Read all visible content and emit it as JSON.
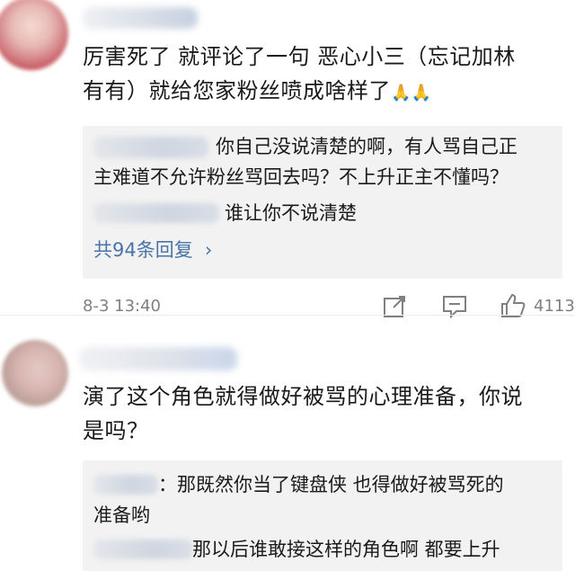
{
  "comments": [
    {
      "content_line1": "厉害死了 就评论了一句 恶心小三（忘记加林",
      "content_line2": "有有）就给您家粉丝喷成啥样了",
      "emoji": "🙏🙏",
      "replies": [
        {
          "text_line1": "你自己没说清楚的啊，有人骂自己正",
          "text_line2": "主难道不允许粉丝骂回去吗？不上升正主不懂吗？"
        },
        {
          "text_line1": "谁让你不说清楚"
        }
      ],
      "more_replies": "共94条回复",
      "timestamp": "8-3 13:40",
      "like_count": "4113"
    },
    {
      "content_line1": "演了这个角色就得做好被骂的心理准备，你说",
      "content_line2": "是吗？",
      "replies": [
        {
          "text_line1": "：那既然你当了键盘侠 也得做好被骂死的",
          "text_line2": "准备哟"
        },
        {
          "text_line1": "那以后谁敢接这样的角色啊 都要上升"
        }
      ]
    }
  ],
  "icons": {
    "share": "share-icon",
    "comment": "comment-icon",
    "like": "thumbs-up-icon"
  }
}
